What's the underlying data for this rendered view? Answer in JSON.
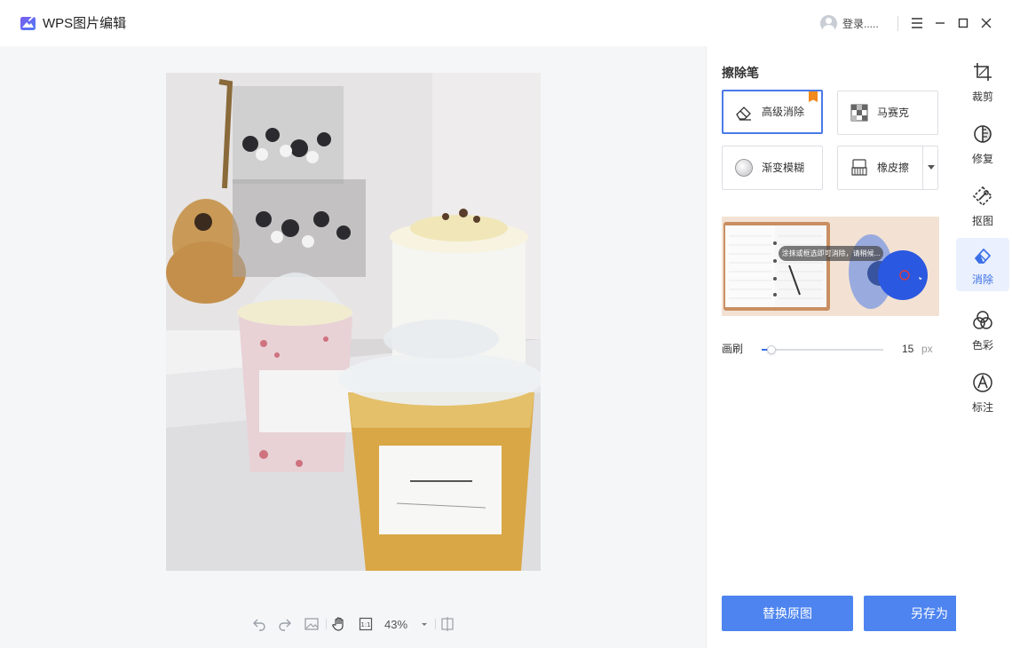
{
  "app": {
    "title": "WPS图片编辑"
  },
  "account": {
    "login_label": "登录....."
  },
  "window_controls": [
    "menu-icon",
    "minimize-icon",
    "maximize-icon",
    "close-icon"
  ],
  "bottom_toolbar": {
    "zoom": "43%",
    "icons": [
      "undo-icon",
      "redo-icon",
      "image-icon",
      "hand-icon",
      "actual-size-icon",
      "zoom-dropdown-icon",
      "compare-icon"
    ]
  },
  "panel": {
    "title": "擦除笔",
    "tools": [
      {
        "label": "高级消除",
        "icon": "eraser-icon",
        "selected": true,
        "premium": true
      },
      {
        "label": "马赛克",
        "icon": "mosaic-icon",
        "selected": false
      },
      {
        "label": "渐变模糊",
        "icon": "blur-icon",
        "selected": false
      },
      {
        "label": "橡皮擦",
        "icon": "rubber-eraser-icon",
        "selected": false,
        "has_dropdown": true
      }
    ],
    "preview_tip": "涂抹或框选即可消除，请稍候...",
    "brush": {
      "label": "画刷",
      "value": "15",
      "unit": "px",
      "level": 0.08
    },
    "buttons": {
      "replace": "替换原图",
      "save_as": "另存为"
    }
  },
  "rail": {
    "items": [
      {
        "label": "裁剪",
        "icon": "crop-icon",
        "active": false
      },
      {
        "label": "修复",
        "icon": "repair-icon",
        "active": false
      },
      {
        "label": "抠图",
        "icon": "cutout-icon",
        "active": false
      },
      {
        "label": "消除",
        "icon": "eraser-icon",
        "active": true
      },
      {
        "label": "色彩",
        "icon": "color-icon",
        "active": false
      },
      {
        "label": "标注",
        "icon": "annotate-icon",
        "active": false
      }
    ]
  },
  "colors": {
    "accent": "#4d84f0",
    "active_border": "#4a7ae8",
    "canvas_bg": "#f5f6f8",
    "rail_active_bg": "#eaf0fd",
    "premium_badge": "#f08a1c"
  }
}
